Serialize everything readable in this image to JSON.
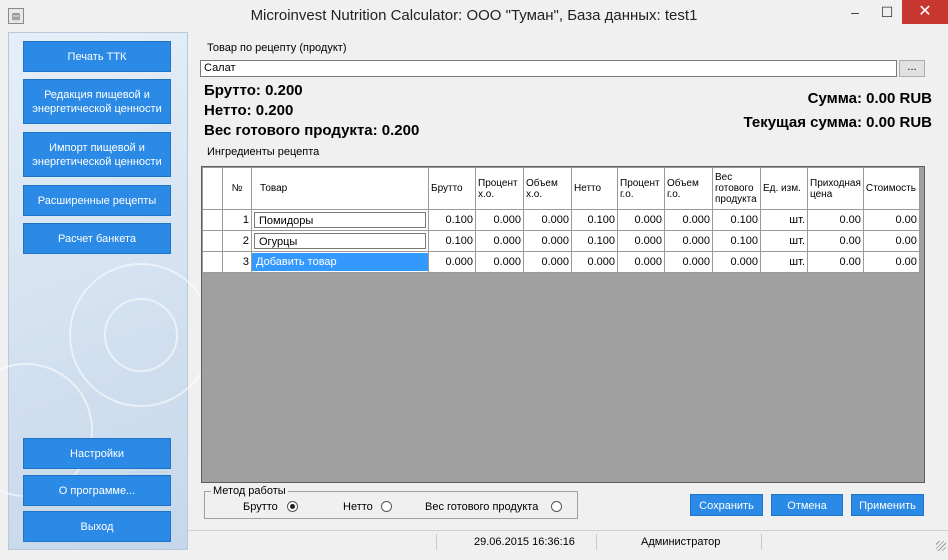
{
  "window": {
    "title": "Microinvest Nutrition Calculator: ООО \"Туман\", База данных: test1",
    "minimize_label": "–",
    "maximize_label": "☐",
    "close_label": "✕"
  },
  "sidebar": {
    "buttons": [
      {
        "label": "Печать ТТК"
      },
      {
        "label": "Редакция пищевой и энергетической ценности"
      },
      {
        "label": "Импорт пищевой и энергетической ценности"
      },
      {
        "label": "Расширенные рецепты"
      },
      {
        "label": "Расчет банкета"
      },
      {
        "label": "Настройки"
      },
      {
        "label": "О программе..."
      },
      {
        "label": "Выход"
      }
    ]
  },
  "product": {
    "label": "Товар по рецепту (продукт)",
    "value": "Салат",
    "browse_label": "..."
  },
  "totals": {
    "brutto": "Брутто: 0.200",
    "netto": "Нетто: 0.200",
    "ready_weight": "Вес готового продукта: 0.200",
    "sum": "Сумма: 0.00 RUB",
    "current_sum": "Текущая сумма: 0.00 RUB"
  },
  "ingredients_label": "Ингредиенты рецепта",
  "grid": {
    "headers": [
      "№",
      "Товар",
      "Брутто",
      "Процент х.о.",
      "Объем х.о.",
      "Нетто",
      "Процент г.о.",
      "Объем г.о.",
      "Вес готового продукта",
      "Ед. изм.",
      "Приходная цена",
      "Стоимость"
    ],
    "rows": [
      {
        "n": "1",
        "name": "Помидоры",
        "brutto": "0.100",
        "pct_ho": "0.000",
        "vol_ho": "0.000",
        "netto": "0.100",
        "pct_go": "0.000",
        "vol_go": "0.000",
        "ready": "0.100",
        "unit": "шт.",
        "price": "0.00",
        "cost": "0.00"
      },
      {
        "n": "2",
        "name": "Огурцы",
        "brutto": "0.100",
        "pct_ho": "0.000",
        "vol_ho": "0.000",
        "netto": "0.100",
        "pct_go": "0.000",
        "vol_go": "0.000",
        "ready": "0.100",
        "unit": "шт.",
        "price": "0.00",
        "cost": "0.00"
      },
      {
        "n": "3",
        "name": "Добавить товар",
        "brutto": "0.000",
        "pct_ho": "0.000",
        "vol_ho": "0.000",
        "netto": "0.000",
        "pct_go": "0.000",
        "vol_go": "0.000",
        "ready": "0.000",
        "unit": "шт.",
        "price": "0.00",
        "cost": "0.00"
      }
    ]
  },
  "method": {
    "legend": "Метод работы",
    "options": [
      {
        "label": "Брутто",
        "selected": true
      },
      {
        "label": "Нетто",
        "selected": false
      },
      {
        "label": "Вес готового продукта",
        "selected": false
      }
    ]
  },
  "actions": {
    "save": "Сохранить",
    "cancel": "Отмена",
    "apply": "Применить"
  },
  "status": {
    "datetime": "29.06.2015 16:36:16",
    "user": "Администратор"
  },
  "colors": {
    "accent": "#2b8ae6",
    "close": "#c7372f",
    "selected_cell": "#3399ff",
    "grid_empty": "#a0a0a0"
  }
}
